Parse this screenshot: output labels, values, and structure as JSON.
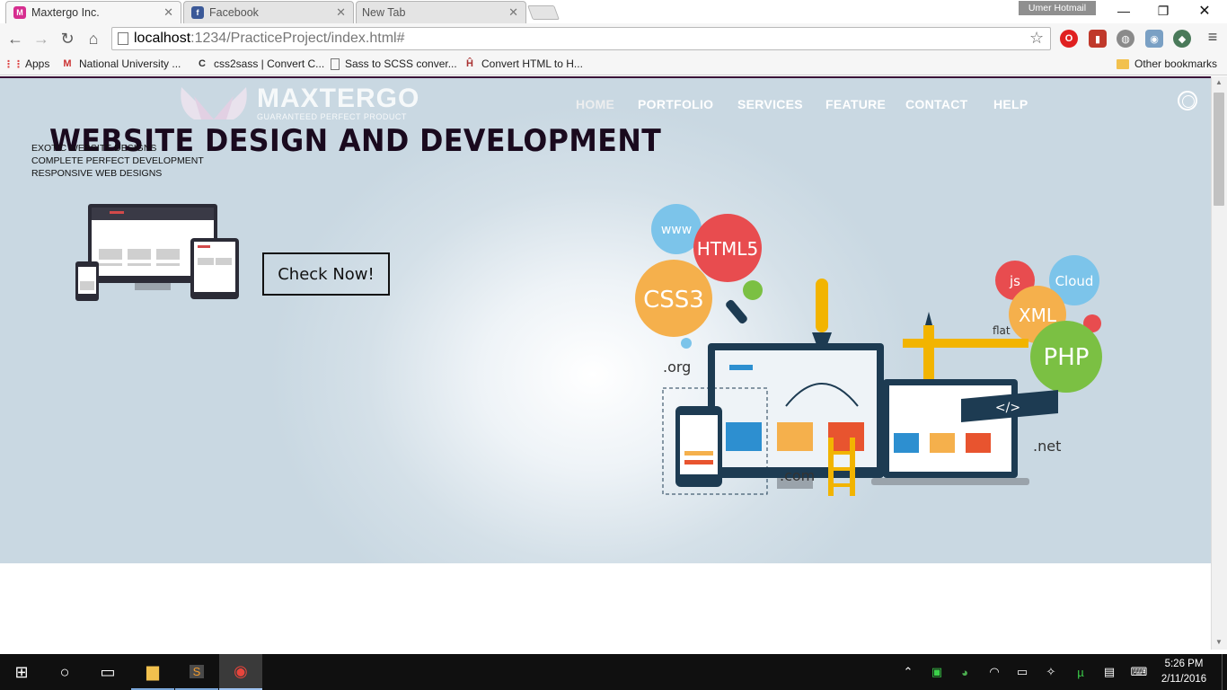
{
  "browser": {
    "tabs": [
      {
        "title": "Maxtergo Inc.",
        "active": true
      },
      {
        "title": "Facebook",
        "active": false
      },
      {
        "title": "New Tab",
        "active": false
      }
    ],
    "profile": "Umer Hotmail",
    "url_host": "localhost",
    "url_path": ":1234/PracticeProject/index.html#",
    "bookmarks": [
      {
        "label": "Apps"
      },
      {
        "label": "National University ..."
      },
      {
        "label": "css2sass | Convert C..."
      },
      {
        "label": "Sass to SCSS conver..."
      },
      {
        "label": "Convert HTML to H..."
      }
    ],
    "other_bookmarks": "Other bookmarks"
  },
  "site": {
    "logo_name": "MAXTERGO",
    "logo_tagline": "GUARANTEED PERFECT PRODUCT",
    "nav": [
      "HOME",
      "PORTFOLIO",
      "SERVICES",
      "FEATURE",
      "CONTACT",
      "HELP"
    ],
    "headline": "WEBSITE DESIGN AND DEVELOPMENT",
    "taglines": [
      "EXOTIC WEBSITE DESIGNS",
      "COMPLETE PERFECT DEVELOPMENT",
      "RESPONSIVE WEB DESIGNS"
    ],
    "cta": "Check Now!",
    "illustration_labels": {
      "www": "www",
      "html5": "HTML5",
      "css3": "CSS3",
      "js": "js",
      "cloud": "Cloud",
      "xml": "XML",
      "php": "PHP",
      "flat": "flat",
      "org": ".org",
      "net": ".net",
      "com": ".com",
      "code": "</>"
    },
    "colors": {
      "accent_dark": "#1a0a1e",
      "hero_bg": "#c9d8e2"
    }
  },
  "taskbar": {
    "time": "5:26 PM",
    "date": "2/11/2016"
  }
}
